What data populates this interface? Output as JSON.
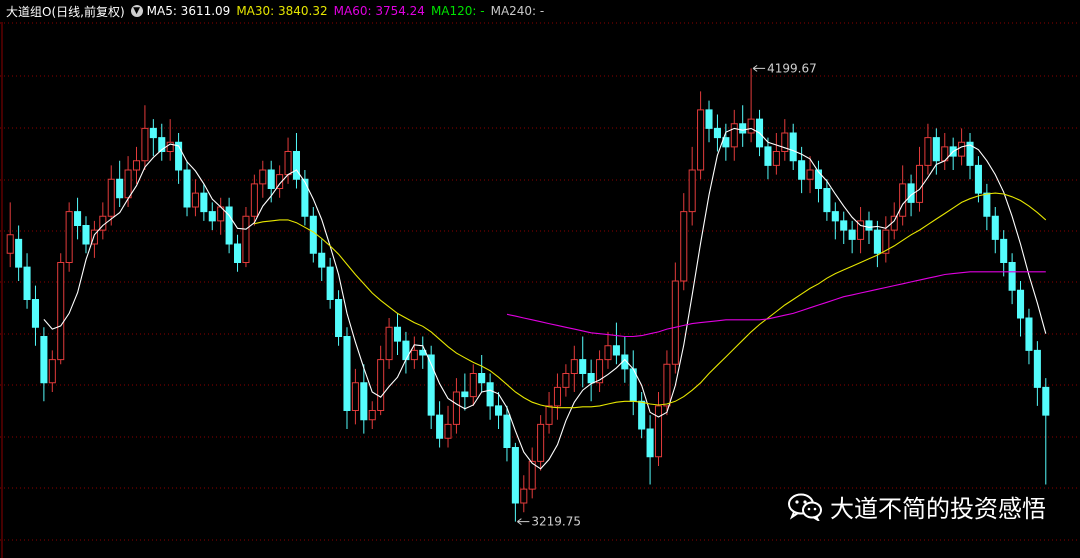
{
  "legend": {
    "stock_name": "大道组O(日线,前复权)",
    "ma5": "MA5: 3611.09",
    "ma30": "MA30: 3840.32",
    "ma60": "MA60: 3754.24",
    "ma120": "MA120: -",
    "ma240": "MA240: -"
  },
  "watermark": {
    "text": "大道不简的投资感悟",
    "icon": "wechat-icon"
  },
  "colors": {
    "background": "#000000",
    "grid": "#8b0000",
    "up": "#e23b3b",
    "down": "#54fcfc",
    "ma5": "#ffffff",
    "ma30": "#e6e600",
    "ma60": "#e000e0",
    "ma120": "#00e000",
    "ma240": "#c8c8c8"
  },
  "chart_data": {
    "type": "candlestick",
    "title": "大道组O(日线,前复权)",
    "ylim": [
      3180,
      4300
    ],
    "grid": true,
    "max_label": "4199.67",
    "min_label": "3219.75",
    "candles": [
      [
        3800,
        3840,
        3910,
        3770
      ],
      [
        3830,
        3770,
        3860,
        3740
      ],
      [
        3770,
        3700,
        3800,
        3680
      ],
      [
        3700,
        3640,
        3730,
        3600
      ],
      [
        3620,
        3520,
        3640,
        3480
      ],
      [
        3520,
        3570,
        3590,
        3500
      ],
      [
        3570,
        3780,
        3800,
        3560
      ],
      [
        3780,
        3890,
        3910,
        3760
      ],
      [
        3890,
        3860,
        3920,
        3830
      ],
      [
        3860,
        3820,
        3880,
        3800
      ],
      [
        3820,
        3850,
        3870,
        3790
      ],
      [
        3850,
        3880,
        3910,
        3830
      ],
      [
        3880,
        3960,
        3990,
        3860
      ],
      [
        3960,
        3920,
        4000,
        3900
      ],
      [
        3920,
        3980,
        4010,
        3900
      ],
      [
        3980,
        4000,
        4030,
        3950
      ],
      [
        4000,
        4070,
        4120,
        3980
      ],
      [
        4070,
        4050,
        4090,
        4010
      ],
      [
        4050,
        4020,
        4080,
        4000
      ],
      [
        4020,
        4040,
        4090,
        4000
      ],
      [
        4040,
        3980,
        4060,
        3950
      ],
      [
        3980,
        3900,
        4000,
        3880
      ],
      [
        3900,
        3930,
        3960,
        3880
      ],
      [
        3930,
        3890,
        3950,
        3870
      ],
      [
        3890,
        3870,
        3910,
        3850
      ],
      [
        3870,
        3900,
        3920,
        3840
      ],
      [
        3900,
        3820,
        3920,
        3800
      ],
      [
        3820,
        3780,
        3840,
        3760
      ],
      [
        3780,
        3880,
        3900,
        3770
      ],
      [
        3880,
        3950,
        3970,
        3860
      ],
      [
        3950,
        3980,
        4000,
        3920
      ],
      [
        3980,
        3940,
        4000,
        3910
      ],
      [
        3940,
        3970,
        3990,
        3920
      ],
      [
        3970,
        4020,
        4050,
        3950
      ],
      [
        4020,
        3960,
        4060,
        3940
      ],
      [
        3960,
        3880,
        3980,
        3860
      ],
      [
        3880,
        3800,
        3900,
        3780
      ],
      [
        3800,
        3770,
        3830,
        3740
      ],
      [
        3770,
        3700,
        3790,
        3680
      ],
      [
        3700,
        3620,
        3720,
        3600
      ],
      [
        3620,
        3460,
        3640,
        3420
      ],
      [
        3460,
        3520,
        3550,
        3430
      ],
      [
        3520,
        3440,
        3560,
        3410
      ],
      [
        3440,
        3460,
        3480,
        3420
      ],
      [
        3460,
        3570,
        3600,
        3450
      ],
      [
        3570,
        3640,
        3660,
        3550
      ],
      [
        3640,
        3610,
        3670,
        3580
      ],
      [
        3610,
        3570,
        3630,
        3540
      ],
      [
        3570,
        3590,
        3620,
        3550
      ],
      [
        3590,
        3580,
        3620,
        3550
      ],
      [
        3580,
        3450,
        3600,
        3420
      ],
      [
        3450,
        3400,
        3480,
        3380
      ],
      [
        3400,
        3430,
        3470,
        3380
      ],
      [
        3430,
        3500,
        3530,
        3410
      ],
      [
        3500,
        3490,
        3540,
        3460
      ],
      [
        3490,
        3540,
        3560,
        3470
      ],
      [
        3540,
        3520,
        3580,
        3500
      ],
      [
        3520,
        3470,
        3540,
        3440
      ],
      [
        3470,
        3450,
        3500,
        3420
      ],
      [
        3450,
        3380,
        3470,
        3350
      ],
      [
        3380,
        3260,
        3390,
        3219.75
      ],
      [
        3260,
        3290,
        3320,
        3240
      ],
      [
        3290,
        3350,
        3380,
        3270
      ],
      [
        3350,
        3430,
        3450,
        3330
      ],
      [
        3430,
        3470,
        3500,
        3410
      ],
      [
        3470,
        3510,
        3540,
        3440
      ],
      [
        3510,
        3540,
        3560,
        3490
      ],
      [
        3540,
        3570,
        3600,
        3500
      ],
      [
        3570,
        3540,
        3620,
        3510
      ],
      [
        3540,
        3520,
        3570,
        3480
      ],
      [
        3520,
        3570,
        3590,
        3500
      ],
      [
        3570,
        3600,
        3630,
        3550
      ],
      [
        3600,
        3580,
        3650,
        3560
      ],
      [
        3580,
        3550,
        3620,
        3520
      ],
      [
        3550,
        3480,
        3590,
        3450
      ],
      [
        3480,
        3420,
        3500,
        3400
      ],
      [
        3420,
        3360,
        3450,
        3300
      ],
      [
        3360,
        3470,
        3500,
        3340
      ],
      [
        3470,
        3560,
        3590,
        3450
      ],
      [
        3560,
        3740,
        3780,
        3540
      ],
      [
        3740,
        3890,
        3930,
        3720
      ],
      [
        3890,
        3980,
        4030,
        3860
      ],
      [
        3980,
        4110,
        4150,
        3960
      ],
      [
        4110,
        4070,
        4130,
        4040
      ],
      [
        4070,
        4050,
        4100,
        4020
      ],
      [
        4050,
        4030,
        4080,
        4000
      ],
      [
        4030,
        4080,
        4110,
        4000
      ],
      [
        4080,
        4060,
        4120,
        4030
      ],
      [
        4060,
        4090,
        4199.67,
        4040
      ],
      [
        4090,
        4030,
        4110,
        4010
      ],
      [
        4030,
        3990,
        4050,
        3960
      ],
      [
        3990,
        4020,
        4060,
        3970
      ],
      [
        4020,
        4060,
        4090,
        4000
      ],
      [
        4060,
        4000,
        4080,
        3980
      ],
      [
        4000,
        3960,
        4030,
        3930
      ],
      [
        3960,
        3980,
        4010,
        3930
      ],
      [
        3980,
        3940,
        4000,
        3910
      ],
      [
        3940,
        3890,
        3960,
        3870
      ],
      [
        3890,
        3870,
        3910,
        3830
      ],
      [
        3870,
        3850,
        3890,
        3820
      ],
      [
        3850,
        3830,
        3870,
        3800
      ],
      [
        3830,
        3870,
        3900,
        3800
      ],
      [
        3870,
        3850,
        3890,
        3820
      ],
      [
        3850,
        3800,
        3870,
        3770
      ],
      [
        3800,
        3850,
        3880,
        3780
      ],
      [
        3850,
        3880,
        3910,
        3830
      ],
      [
        3880,
        3950,
        3990,
        3860
      ],
      [
        3950,
        3910,
        3970,
        3880
      ],
      [
        3910,
        3990,
        4030,
        3890
      ],
      [
        3990,
        4050,
        4080,
        3970
      ],
      [
        4050,
        4000,
        4070,
        3970
      ],
      [
        4000,
        4030,
        4060,
        3980
      ],
      [
        4030,
        4010,
        4050,
        3980
      ],
      [
        4010,
        4040,
        4070,
        3990
      ],
      [
        4040,
        3990,
        4060,
        3960
      ],
      [
        3990,
        3930,
        4010,
        3910
      ],
      [
        3930,
        3880,
        3950,
        3850
      ],
      [
        3880,
        3830,
        3900,
        3800
      ],
      [
        3830,
        3780,
        3850,
        3750
      ],
      [
        3780,
        3720,
        3800,
        3690
      ],
      [
        3720,
        3660,
        3740,
        3620
      ],
      [
        3660,
        3590,
        3680,
        3560
      ],
      [
        3590,
        3510,
        3610,
        3470
      ],
      [
        3510,
        3450,
        3530,
        3300
      ]
    ],
    "ma5": [
      null,
      null,
      null,
      null,
      3657,
      3636,
      3643,
      3670,
      3715,
      3786,
      3840,
      3860,
      3874,
      3888,
      3918,
      3946,
      3986,
      4007,
      4024,
      4036,
      4032,
      3998,
      3978,
      3950,
      3917,
      3900,
      3882,
      3854,
      3852,
      3866,
      3902,
      3924,
      3950,
      3970,
      3980,
      3954,
      3917,
      3873,
      3816,
      3754,
      3670,
      3608,
      3552,
      3500,
      3489,
      3512,
      3532,
      3570,
      3602,
      3600,
      3560,
      3518,
      3486,
      3474,
      3464,
      3472,
      3500,
      3504,
      3496,
      3466,
      3416,
      3370,
      3346,
      3334,
      3354,
      3386,
      3438,
      3478,
      3504,
      3518,
      3526,
      3538,
      3552,
      3570,
      3550,
      3514,
      3456,
      3446,
      3456,
      3514,
      3602,
      3710,
      3822,
      3926,
      4012,
      4062,
      4070,
      4066,
      4070,
      4060,
      4040,
      4034,
      4028,
      4022,
      4014,
      4004,
      3976,
      3956,
      3928,
      3902,
      3878,
      3860,
      3856,
      3858,
      3854,
      3870,
      3906,
      3926,
      3938,
      3964,
      3992,
      4000,
      4020,
      4030,
      4034,
      4024,
      4000,
      3970,
      3932,
      3880,
      3820,
      3752,
      3692,
      3626
    ],
    "ma30": [
      null,
      null,
      null,
      null,
      null,
      null,
      null,
      null,
      null,
      null,
      null,
      null,
      null,
      null,
      null,
      null,
      null,
      null,
      null,
      null,
      null,
      null,
      null,
      null,
      null,
      null,
      null,
      null,
      null,
      3864,
      3868,
      3870,
      3872,
      3872,
      3866,
      3856,
      3846,
      3832,
      3816,
      3798,
      3776,
      3754,
      3734,
      3714,
      3698,
      3684,
      3670,
      3660,
      3650,
      3642,
      3630,
      3614,
      3598,
      3584,
      3574,
      3564,
      3556,
      3546,
      3532,
      3516,
      3500,
      3488,
      3478,
      3472,
      3468,
      3466,
      3466,
      3466,
      3468,
      3468,
      3470,
      3474,
      3478,
      3480,
      3480,
      3478,
      3474,
      3472,
      3474,
      3480,
      3490,
      3504,
      3520,
      3540,
      3558,
      3576,
      3594,
      3612,
      3630,
      3646,
      3660,
      3674,
      3688,
      3700,
      3712,
      3724,
      3734,
      3746,
      3756,
      3764,
      3772,
      3780,
      3788,
      3796,
      3806,
      3816,
      3828,
      3840,
      3850,
      3862,
      3874,
      3886,
      3898,
      3910,
      3918,
      3924,
      3928,
      3930,
      3928,
      3922,
      3914,
      3902,
      3888,
      3872
    ],
    "ma60": [
      null,
      null,
      null,
      null,
      null,
      null,
      null,
      null,
      null,
      null,
      null,
      null,
      null,
      null,
      null,
      null,
      null,
      null,
      null,
      null,
      null,
      null,
      null,
      null,
      null,
      null,
      null,
      null,
      null,
      null,
      null,
      null,
      null,
      null,
      null,
      null,
      null,
      null,
      null,
      null,
      null,
      null,
      null,
      null,
      null,
      null,
      null,
      null,
      null,
      null,
      null,
      null,
      null,
      null,
      null,
      null,
      null,
      null,
      null,
      3668,
      3664,
      3660,
      3656,
      3652,
      3648,
      3644,
      3640,
      3636,
      3632,
      3628,
      3626,
      3624,
      3622,
      3620,
      3620,
      3622,
      3626,
      3630,
      3636,
      3640,
      3644,
      3648,
      3650,
      3652,
      3654,
      3656,
      3656,
      3656,
      3656,
      3656,
      3658,
      3662,
      3666,
      3670,
      3676,
      3682,
      3688,
      3694,
      3700,
      3706,
      3710,
      3714,
      3718,
      3722,
      3726,
      3730,
      3734,
      3738,
      3742,
      3746,
      3750,
      3754,
      3756,
      3758,
      3760,
      3760,
      3760,
      3760,
      3760,
      3760,
      3760,
      3760,
      3760,
      3760
    ]
  }
}
